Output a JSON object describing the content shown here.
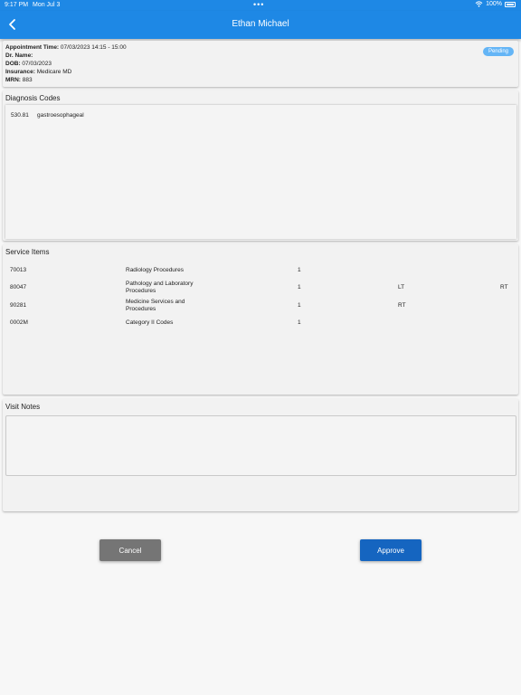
{
  "status_bar": {
    "time": "9:17 PM",
    "date": "Mon Jul 3",
    "dots": "•••",
    "battery": "100%"
  },
  "nav": {
    "title": "Ethan Michael",
    "back_icon": "chevron-left-icon"
  },
  "patient": {
    "appointment_label": "Appointment Time:",
    "appointment_value": "07/03/2023 14:15 - 15:00",
    "doctor_label": "Dr. Name:",
    "doctor_value": "",
    "dob_label": "DOB:",
    "dob_value": "07/03/2023",
    "insurance_label": "Insurance:",
    "insurance_value": "Medicare MD",
    "mrn_label": "MRN:",
    "mrn_value": "883",
    "status": "Pending"
  },
  "diagnosis": {
    "title": "Diagnosis Codes",
    "items": [
      {
        "code": "530.81",
        "description": "gastroesophageal"
      }
    ]
  },
  "services": {
    "title": "Service Items",
    "items": [
      {
        "code": "70013",
        "description": "Radiology Procedures",
        "qty": "1",
        "mod1": "",
        "mod2": ""
      },
      {
        "code": "80047",
        "description": "Pathology and Laboratory Procedures",
        "qty": "1",
        "mod1": "LT",
        "mod2": "RT"
      },
      {
        "code": "90281",
        "description": "Medicine Services and Procedures",
        "qty": "1",
        "mod1": "RT",
        "mod2": ""
      },
      {
        "code": "0002M",
        "description": "Category II Codes",
        "qty": "1",
        "mod1": "",
        "mod2": ""
      }
    ]
  },
  "notes": {
    "title": "Visit Notes",
    "value": ""
  },
  "actions": {
    "cancel_label": "Cancel",
    "approve_label": "Approve"
  },
  "colors": {
    "primary": "#1e88e5",
    "approve": "#1565c0",
    "cancel": "#757575",
    "badge": "#64b5f6"
  }
}
